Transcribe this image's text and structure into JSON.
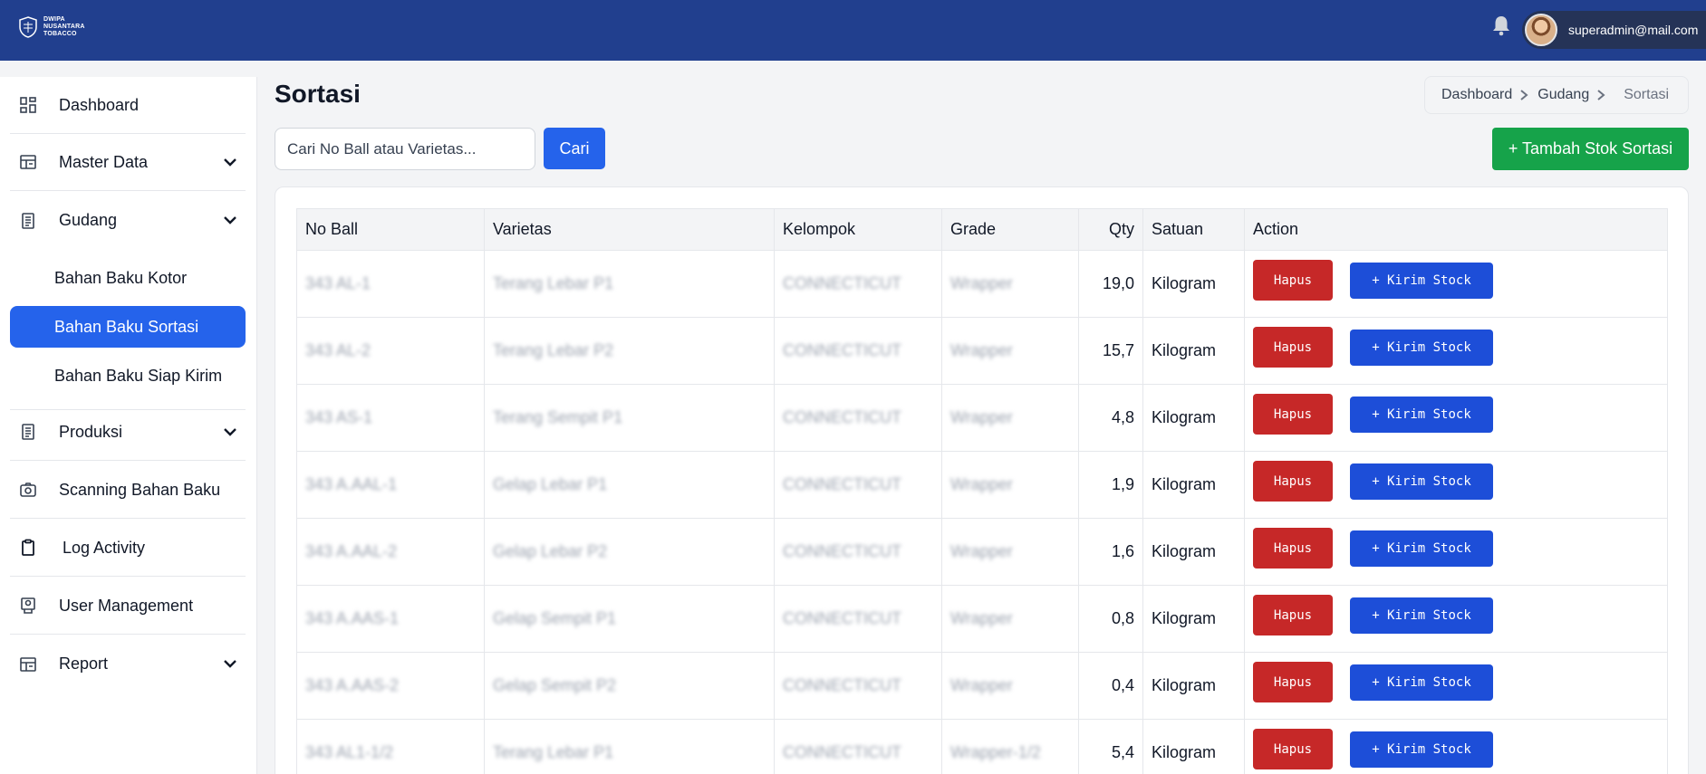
{
  "brand": {
    "line1": "DWIPA",
    "line2": "NUSANTARA",
    "line3": "TOBACCO"
  },
  "user": {
    "email": "superadmin@mail.com"
  },
  "sidebar": {
    "items": [
      {
        "label": "Dashboard",
        "icon": "dashboard-grid-icon"
      },
      {
        "label": "Master Data",
        "icon": "table-icon"
      },
      {
        "label": "Gudang",
        "icon": "document-icon"
      },
      {
        "label": "Produksi",
        "icon": "document-icon"
      },
      {
        "label": "Scanning Bahan Baku",
        "icon": "camera-icon"
      },
      {
        "label": "Log Activity",
        "icon": "clipboard-icon"
      },
      {
        "label": "User Management",
        "icon": "user-badge-icon"
      },
      {
        "label": "Report",
        "icon": "table-icon"
      }
    ],
    "gudang_sub": [
      "Bahan Baku Kotor",
      "Bahan Baku Sortasi",
      "Bahan Baku Siap Kirim"
    ],
    "active_sub": "Bahan Baku Sortasi"
  },
  "page": {
    "title": "Sortasi"
  },
  "breadcrumb": {
    "items": [
      "Dashboard",
      "Gudang"
    ],
    "current": "Sortasi"
  },
  "search": {
    "placeholder": "Cari No Ball atau Varietas...",
    "button": "Cari"
  },
  "add_button": "+ Tambah Stok Sortasi",
  "table": {
    "headers": [
      "No Ball",
      "Varietas",
      "Kelompok",
      "Grade",
      "Qty",
      "Satuan",
      "Action"
    ],
    "rows": [
      {
        "no_ball": "343 AL-1",
        "varietas": "Terang Lebar P1",
        "kelompok": "CONNECTICUT",
        "grade": "Wrapper",
        "qty": "19,0",
        "satuan": "Kilogram"
      },
      {
        "no_ball": "343 AL-2",
        "varietas": "Terang Lebar P2",
        "kelompok": "CONNECTICUT",
        "grade": "Wrapper",
        "qty": "15,7",
        "satuan": "Kilogram"
      },
      {
        "no_ball": "343 AS-1",
        "varietas": "Terang Sempit P1",
        "kelompok": "CONNECTICUT",
        "grade": "Wrapper",
        "qty": "4,8",
        "satuan": "Kilogram"
      },
      {
        "no_ball": "343 A.AAL-1",
        "varietas": "Gelap Lebar P1",
        "kelompok": "CONNECTICUT",
        "grade": "Wrapper",
        "qty": "1,9",
        "satuan": "Kilogram"
      },
      {
        "no_ball": "343 A.AAL-2",
        "varietas": "Gelap Lebar P2",
        "kelompok": "CONNECTICUT",
        "grade": "Wrapper",
        "qty": "1,6",
        "satuan": "Kilogram"
      },
      {
        "no_ball": "343 A.AAS-1",
        "varietas": "Gelap Sempit P1",
        "kelompok": "CONNECTICUT",
        "grade": "Wrapper",
        "qty": "0,8",
        "satuan": "Kilogram"
      },
      {
        "no_ball": "343 A.AAS-2",
        "varietas": "Gelap Sempit P2",
        "kelompok": "CONNECTICUT",
        "grade": "Wrapper",
        "qty": "0,4",
        "satuan": "Kilogram"
      },
      {
        "no_ball": "343 AL1-1/2",
        "varietas": "Terang Lebar P1",
        "kelompok": "CONNECTICUT",
        "grade": "Wrapper-1/2",
        "qty": "5,4",
        "satuan": "Kilogram"
      }
    ],
    "action_delete": "Hapus",
    "action_send": "+ Kirim Stock"
  },
  "colors": {
    "topbar": "#213f8e",
    "primary": "#2563eb",
    "success": "#16a34a",
    "danger": "#c62828"
  }
}
